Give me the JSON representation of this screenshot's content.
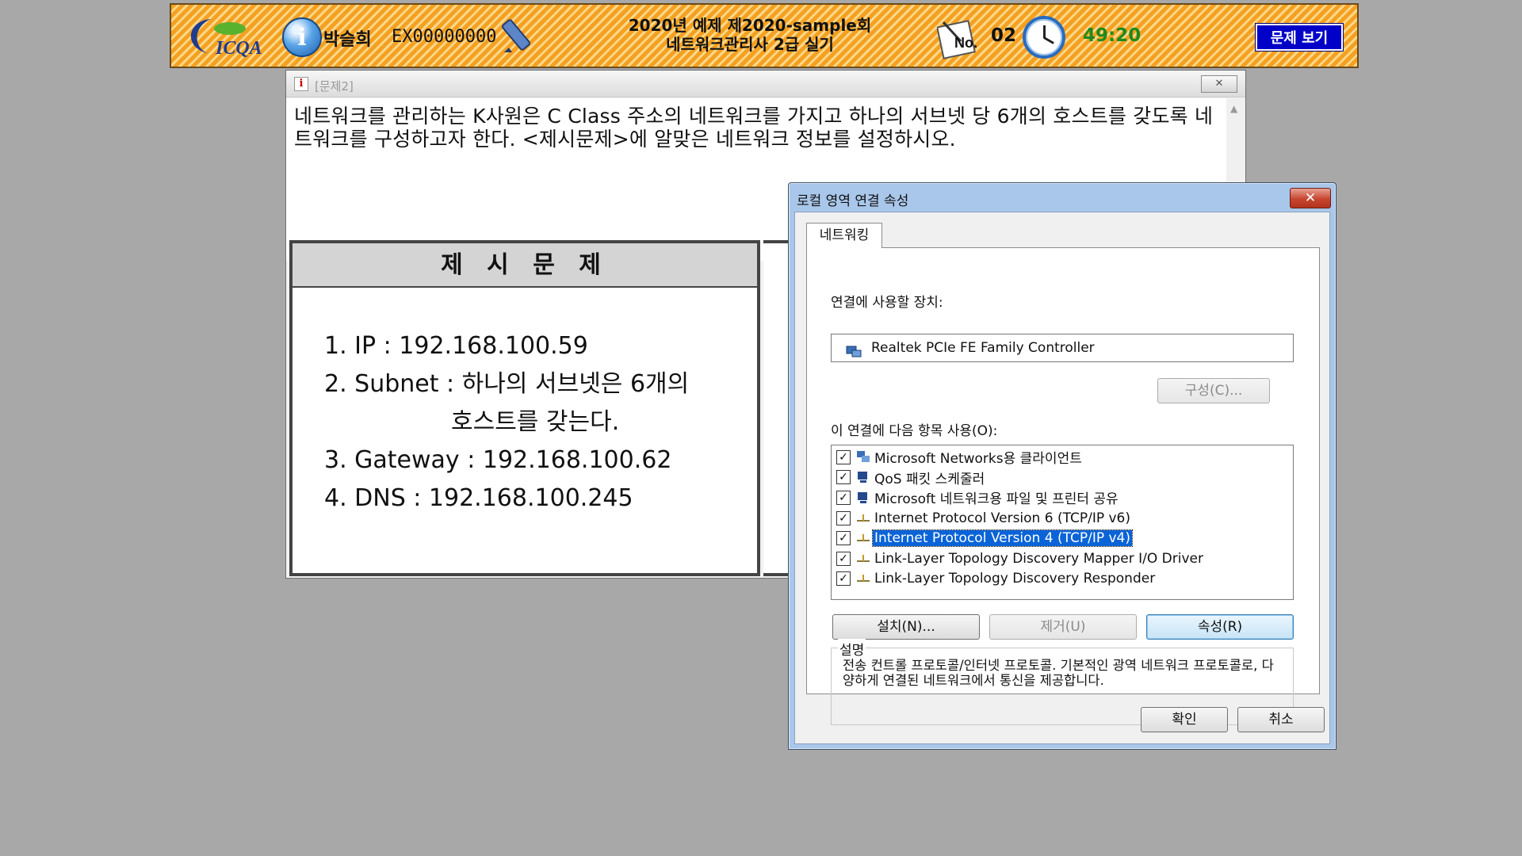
{
  "header": {
    "logo_text": "ICQA",
    "candidate_name": "박슬희",
    "exam_number": "EX00000000",
    "exam_title_line1": "2020년 예제 제2020-sample회",
    "exam_title_line2": "네트워크관리사 2급 실기",
    "question_no_label": "No.",
    "question_no": "02",
    "timer": "49:20",
    "view_problem_button": "문제 보기"
  },
  "question_window": {
    "title": "[문제2]",
    "close_label": "✕",
    "question_text": "네트워크를 관리하는 K사원은 C Class 주소의 네트워크를 가지고 하나의 서브넷 당 6개의 호스트를 갖도록 네트워크를 구성하고자 한다. <제시문제>에 알맞은 네트워크 정보를 설정하시오.",
    "problem_title": "제 시 문 제",
    "problem_items": [
      "1. IP : 192.168.100.59",
      "2. Subnet : 하나의 서브넷은 6개의",
      "호스트를 갖는다.",
      "3. Gateway : 192.168.100.62",
      "4. DNS : 192.168.100.245"
    ]
  },
  "dialog": {
    "title": "로컬 영역 연결 속성",
    "close_label": "✕",
    "tab": "네트워킹",
    "device_label": "연결에 사용할 장치:",
    "device_name": "Realtek PCIe FE Family Controller",
    "configure_button": "구성(C)...",
    "items_label": "이 연결에 다음 항목 사용(O):",
    "items": [
      {
        "label": "Microsoft Networks용 클라이언트",
        "checked": true,
        "icon": "network-client-icon"
      },
      {
        "label": "QoS 패킷 스케줄러",
        "checked": true,
        "icon": "network-service-icon"
      },
      {
        "label": "Microsoft 네트워크용 파일 및 프린터 공유",
        "checked": true,
        "icon": "network-service-icon"
      },
      {
        "label": "Internet Protocol Version 6 (TCP/IP v6)",
        "checked": true,
        "icon": "protocol-icon"
      },
      {
        "label": "Internet Protocol Version 4 (TCP/IP v4)",
        "checked": true,
        "icon": "protocol-icon",
        "selected": true
      },
      {
        "label": "Link-Layer Topology Discovery Mapper I/O Driver",
        "checked": true,
        "icon": "protocol-icon"
      },
      {
        "label": "Link-Layer Topology Discovery Responder",
        "checked": true,
        "icon": "protocol-icon"
      }
    ],
    "install_button": "설치(N)...",
    "uninstall_button": "제거(U)",
    "properties_button": "속성(R)",
    "description_legend": "설명",
    "description_text": "전송 컨트롤 프로토콜/인터넷 프로토콜. 기본적인 광역 네트워크 프로토콜로, 다양하게 연결된 네트워크에서 통신을 제공합니다.",
    "ok_button": "확인",
    "cancel_button": "취소"
  }
}
